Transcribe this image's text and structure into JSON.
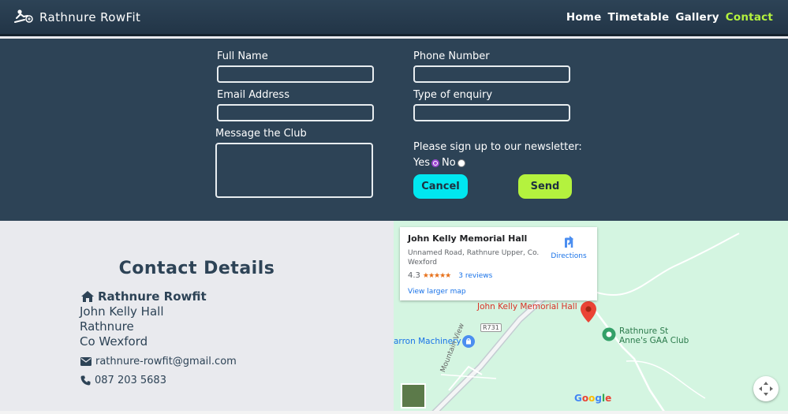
{
  "navbar": {
    "brand": "Rathnure RowFit",
    "links": [
      "Home",
      "Timetable",
      "Gallery",
      "Contact"
    ],
    "active": "Contact"
  },
  "form": {
    "full_name_label": "Full Name",
    "phone_label": "Phone Number",
    "email_label": "Email Address",
    "enquiry_label": "Type of enquiry",
    "message_label": "Message the Club",
    "newsletter_label": "Please sign up to our newsletter:",
    "yes_label": "Yes",
    "no_label": "No",
    "newsletter_selected": "Yes",
    "cancel_label": "Cancel",
    "send_label": "Send"
  },
  "contact": {
    "title": "Contact Details",
    "club_name": "Rathnure Rowfit",
    "address_lines": [
      "John Kelly Hall",
      "Rathnure",
      "Co Wexford"
    ],
    "email": "rathnure-rowfit@gmail.com",
    "phone": "087 203 5683"
  },
  "map": {
    "card_title": "John Kelly Memorial Hall",
    "card_address": "Unnamed Road, Rathnure Upper, Co. Wexford",
    "rating": "4.3",
    "stars": "★★★★★",
    "reviews": "3 reviews",
    "larger_map": "View larger map",
    "directions": "Directions",
    "pin_label": "John Kelly Memorial Hall",
    "place_gaa_line1": "Rathnure St",
    "place_gaa_line2": "Anne's GAA Club",
    "place_machinery": "arron Machinery",
    "road_label": "R731",
    "mountain_view": "Mountain View",
    "google": "Google"
  },
  "colors": {
    "navy": "#2d4356",
    "accent_green": "#b4f23e",
    "accent_cyan": "#00e7f0",
    "map_bg": "#d4f5e1",
    "pin_red": "#ea4335"
  }
}
